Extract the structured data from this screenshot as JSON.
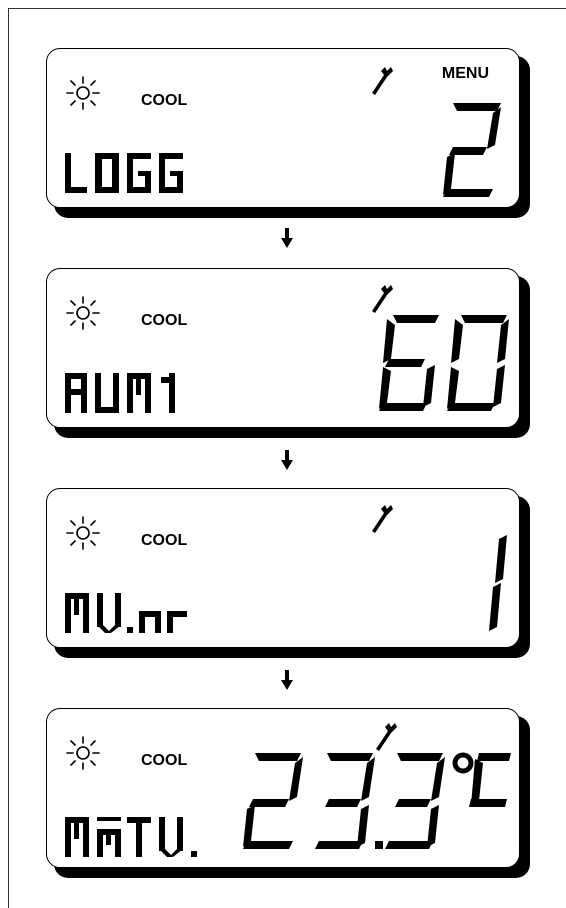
{
  "panels": [
    {
      "mode": "COOL",
      "menu": "MENU",
      "left_text": "LOGG",
      "right_value": "2"
    },
    {
      "mode": "COOL",
      "left_text": "RUM1",
      "right_value": "60"
    },
    {
      "mode": "COOL",
      "left_text": "MV.nr",
      "right_value": "1"
    },
    {
      "mode": "COOL",
      "left_text": "MaTV.",
      "right_value": "23.3°C"
    }
  ],
  "icons": [
    "sun-icon",
    "wrench-icon",
    "down-arrow-icon"
  ]
}
